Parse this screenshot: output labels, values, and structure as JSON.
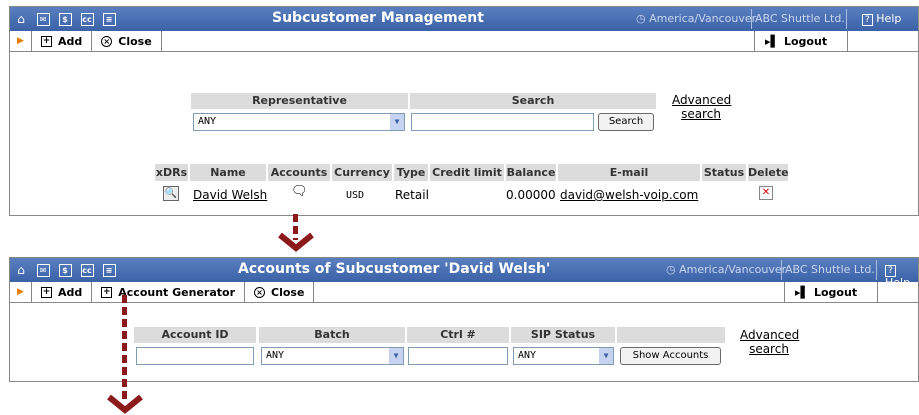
{
  "panel1": {
    "title": "Subcustomer Management",
    "timezone": "America/Vancouver",
    "company": "ABC Shuttle Ltd.",
    "help": "Help",
    "toolbar": {
      "add": "Add",
      "close": "Close",
      "logout": "Logout"
    },
    "search": {
      "representative_label": "Representative",
      "representative_value": "ANY",
      "search_label": "Search",
      "search_value": "",
      "search_button": "Search",
      "advanced_line1": "Advanced",
      "advanced_line2": "search"
    },
    "table": {
      "columns": [
        "xDRs",
        "Name",
        "Accounts",
        "Currency",
        "Type",
        "Credit limit",
        "Balance",
        "E-mail",
        "Status",
        "Delete"
      ],
      "rows": [
        {
          "name": "David Welsh",
          "currency": "USD",
          "type": "Retail",
          "credit_limit": "",
          "balance": "0.00000",
          "email": "david@welsh-voip.com",
          "status": ""
        }
      ]
    }
  },
  "panel2": {
    "title": "Accounts of Subcustomer 'David Welsh'",
    "timezone": "America/Vancouver",
    "company": "ABC Shuttle Ltd.",
    "help": "Help",
    "toolbar": {
      "add": "Add",
      "generator": "Account Generator",
      "close": "Close",
      "logout": "Logout"
    },
    "filters": {
      "account_id_label": "Account ID",
      "account_id_value": "",
      "batch_label": "Batch",
      "batch_value": "ANY",
      "ctrl_label": "Ctrl #",
      "ctrl_value": "",
      "sip_label": "SIP Status",
      "sip_value": "ANY",
      "show_button": "Show Accounts",
      "advanced_line1": "Advanced",
      "advanced_line2": "search"
    }
  },
  "colors": {
    "titlebar": "#3b62a8",
    "arrow": "#8b1a1a",
    "toolbar_marker": "#e87b00"
  }
}
